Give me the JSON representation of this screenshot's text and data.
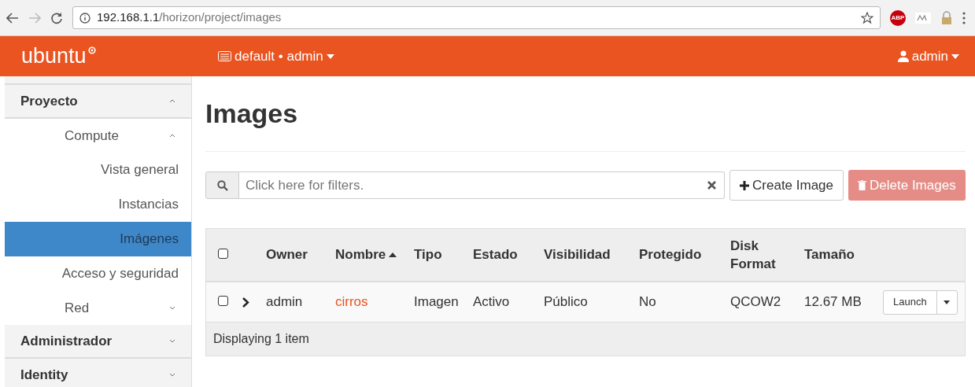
{
  "browser": {
    "url_host": "192.168.1.1",
    "url_path": "/horizon/project/images",
    "extension_label": "ABP"
  },
  "header": {
    "logo": "ubuntu",
    "project_menu": "default • admin",
    "user_menu": "admin"
  },
  "sidebar": {
    "items": [
      {
        "label": "Proyecto",
        "expanded": true,
        "selected": false,
        "children": [
          {
            "label": "Compute",
            "expanded": true,
            "selected": false,
            "children": [
              {
                "label": "Vista general",
                "selected": false
              },
              {
                "label": "Instancias",
                "selected": false
              },
              {
                "label": "Imágenes",
                "selected": true
              },
              {
                "label": "Acceso y seguridad",
                "selected": false
              }
            ]
          },
          {
            "label": "Red",
            "expanded": false,
            "selected": false
          }
        ]
      },
      {
        "label": "Administrador",
        "expanded": false,
        "selected": false
      },
      {
        "label": "Identity",
        "expanded": false,
        "selected": false
      }
    ]
  },
  "page": {
    "title": "Images"
  },
  "toolbar": {
    "filter_placeholder": "Click here for filters.",
    "create_button": "Create Image",
    "delete_button": "Delete Images",
    "delete_disabled": true
  },
  "table": {
    "columns": [
      {
        "label": "Owner",
        "sorted": false
      },
      {
        "label": "Nombre",
        "sorted": true
      },
      {
        "label": "Tipo",
        "sorted": false
      },
      {
        "label": "Estado",
        "sorted": false
      },
      {
        "label": "Visibilidad",
        "sorted": false
      },
      {
        "label": "Protegido",
        "sorted": false
      },
      {
        "label": "Disk Format",
        "sorted": false
      },
      {
        "label": "Tamaño",
        "sorted": false
      }
    ],
    "rows": [
      {
        "checked": false,
        "owner": "admin",
        "name": "cirros",
        "type": "Imagen",
        "status": "Activo",
        "visibility": "Público",
        "protected": "No",
        "disk_format": "QCOW2",
        "size": "12.67 MB",
        "action": "Launch"
      }
    ],
    "select_all_checked": false,
    "footer": "Displaying 1 item"
  }
}
